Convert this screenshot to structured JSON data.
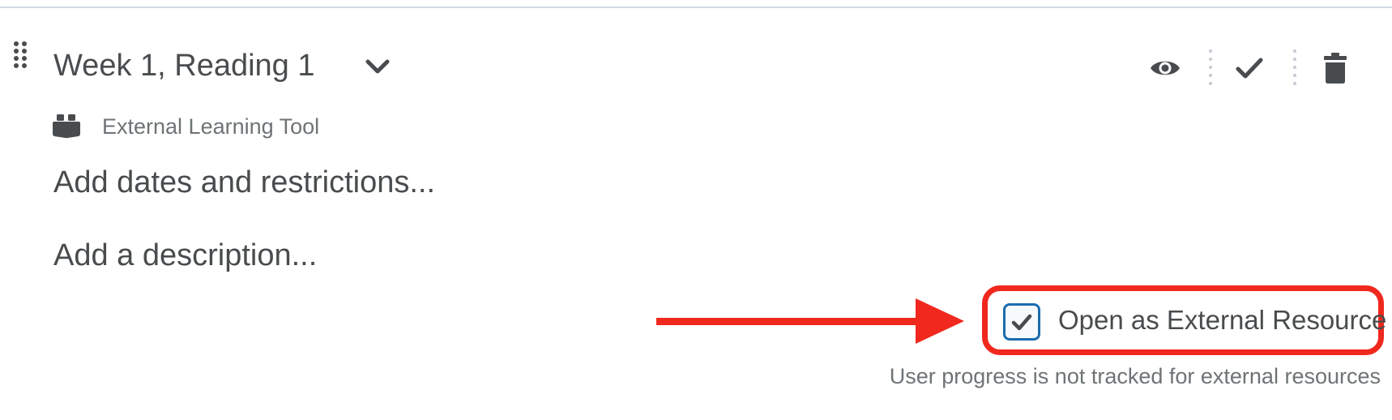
{
  "item": {
    "title": "Week 1, Reading 1",
    "type_label": "External Learning Tool",
    "dates_link": "Add dates and restrictions...",
    "description_link": "Add a description..."
  },
  "toolbar": {
    "icons": [
      "eye-icon",
      "checkmark-icon",
      "trash-icon"
    ]
  },
  "external": {
    "checkbox_label": "Open as External Resource",
    "checked": true,
    "hint": "User progress is not tracked for external resources"
  },
  "colors": {
    "text": "#494c4e",
    "muted": "#6e7376",
    "accent": "#1a6cb0",
    "annotation_red": "#f0281e",
    "rule": "#d3d9e3"
  }
}
